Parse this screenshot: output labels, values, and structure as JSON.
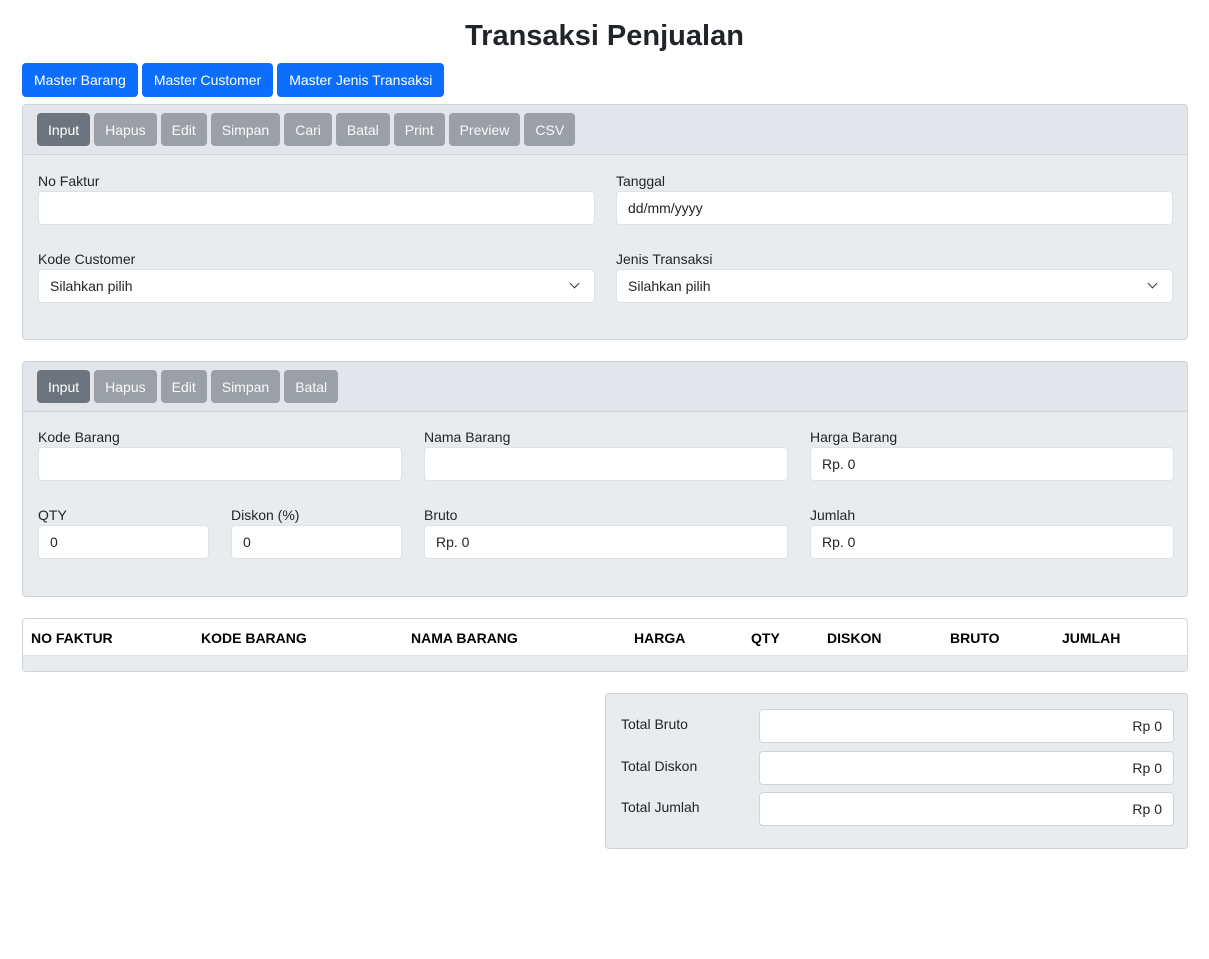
{
  "page": {
    "title": "Transaksi Penjualan"
  },
  "nav": [
    "Master Barang",
    "Master Customer",
    "Master Jenis Transaksi"
  ],
  "header_toolbar": [
    "Input",
    "Hapus",
    "Edit",
    "Simpan",
    "Cari",
    "Batal",
    "Print",
    "Preview",
    "CSV"
  ],
  "header_form": {
    "no_faktur": {
      "label": "No Faktur",
      "value": ""
    },
    "tanggal": {
      "label": "Tanggal",
      "value": "dd/mm/yyyy"
    },
    "kode_customer": {
      "label": "Kode Customer",
      "selected": "Silahkan pilih"
    },
    "jenis_transaksi": {
      "label": "Jenis Transaksi",
      "selected": "Silahkan pilih"
    }
  },
  "detail_toolbar": [
    "Input",
    "Hapus",
    "Edit",
    "Simpan",
    "Batal"
  ],
  "detail_form": {
    "kode_barang": {
      "label": "Kode Barang",
      "value": ""
    },
    "nama_barang": {
      "label": "Nama Barang",
      "value": ""
    },
    "harga_barang": {
      "label": "Harga Barang",
      "value": "Rp. 0"
    },
    "qty": {
      "label": "QTY",
      "value": "0"
    },
    "diskon": {
      "label": "Diskon (%)",
      "value": "0"
    },
    "bruto": {
      "label": "Bruto",
      "value": "Rp. 0"
    },
    "jumlah": {
      "label": "Jumlah",
      "value": "Rp. 0"
    }
  },
  "table": {
    "columns": [
      "NO FAKTUR",
      "KODE BARANG",
      "NAMA BARANG",
      "HARGA",
      "QTY",
      "DISKON",
      "BRUTO",
      "JUMLAH"
    ],
    "rows": []
  },
  "totals": {
    "bruto": {
      "label": "Total Bruto",
      "value": "Rp 0"
    },
    "diskon": {
      "label": "Total Diskon",
      "value": "Rp 0"
    },
    "jumlah": {
      "label": "Total Jumlah",
      "value": "Rp 0"
    }
  },
  "colors": {
    "primary": "#0d6efd",
    "secondary": "#6c757d",
    "panel": "#e9ecef"
  }
}
